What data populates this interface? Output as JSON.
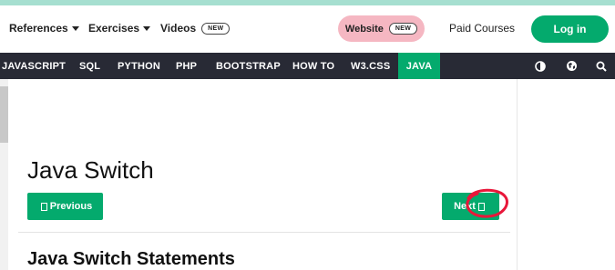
{
  "topbar": {
    "references": "References",
    "exercises": "Exercises",
    "videos": "Videos",
    "videos_badge": "NEW",
    "website": "Website",
    "website_badge": "NEW",
    "paid_courses": "Paid Courses",
    "login": "Log in"
  },
  "nav": {
    "items": [
      "JAVASCRIPT",
      "SQL",
      "PYTHON",
      "PHP",
      "BOOTSTRAP",
      "HOW TO",
      "W3.CSS",
      "JAVA"
    ],
    "active": "JAVA"
  },
  "icons": [
    "contrast-icon",
    "globe-icon",
    "search-icon"
  ],
  "content": {
    "title": "Java Switch",
    "prev_label": "Previous",
    "next_label": "Next",
    "section_title": "Java Switch Statements"
  },
  "colors": {
    "accent": "#04aa6d",
    "navbar": "#282a35",
    "website_pill": "#f5b7c2",
    "annotation": "#e8173a"
  }
}
